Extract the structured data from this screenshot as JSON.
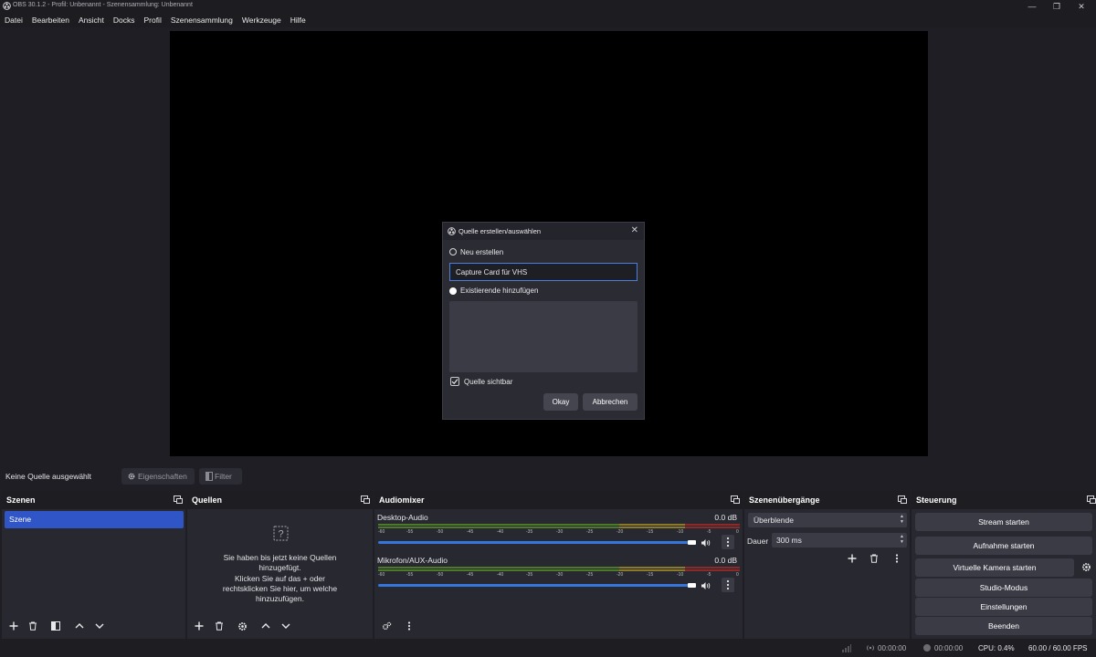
{
  "window": {
    "title": "OBS 30.1.2 - Profil: Unbenannt - Szenensammlung: Unbenannt",
    "minimize": "—",
    "maximize": "❐",
    "close": "✕"
  },
  "menu": [
    "Datei",
    "Bearbeiten",
    "Ansicht",
    "Docks",
    "Profil",
    "Szenensammlung",
    "Werkzeuge",
    "Hilfe"
  ],
  "dialog": {
    "title": "Quelle erstellen/auswählen",
    "close": "✕",
    "create_new_label": "Neu erstellen",
    "name_value": "Capture Card für VHS",
    "add_existing_label": "Existierende hinzufügen",
    "visible_label": "Quelle sichtbar",
    "visible_checked": true,
    "ok_label": "Okay",
    "cancel_label": "Abbrechen"
  },
  "sourcebar": {
    "no_source": "Keine Quelle ausgewählt",
    "properties": "Eigenschaften",
    "filters": "Filter"
  },
  "scenes": {
    "title": "Szenen",
    "items": [
      "Szene"
    ]
  },
  "sources": {
    "title": "Quellen",
    "empty_lines": [
      "Sie haben bis jetzt keine Quellen",
      "hinzugefügt.",
      "Klicken Sie auf das + oder",
      "rechtsklicken Sie hier, um welche",
      "hinzuzufügen."
    ]
  },
  "mixer": {
    "title": "Audiomixer",
    "tick_labels": [
      "-60",
      "-55",
      "-50",
      "-45",
      "-40",
      "-35",
      "-30",
      "-25",
      "-20",
      "-15",
      "-10",
      "-5",
      "0"
    ],
    "channels": [
      {
        "name": "Desktop-Audio",
        "db": "0.0 dB",
        "volume_fraction": 1.0
      },
      {
        "name": "Mikrofon/AUX-Audio",
        "db": "0.0 dB",
        "volume_fraction": 1.0
      }
    ]
  },
  "transitions": {
    "title": "Szenenübergänge",
    "selected": "Überblende",
    "duration_label": "Dauer",
    "duration_value": "300 ms"
  },
  "controls": {
    "title": "Steuerung",
    "stream": "Stream starten",
    "record": "Aufnahme starten",
    "virtualcam": "Virtuelle Kamera starten",
    "studio": "Studio-Modus",
    "settings": "Einstellungen",
    "exit": "Beenden"
  },
  "status": {
    "stream_time": "00:00:00",
    "record_time": "00:00:00",
    "cpu": "CPU: 0.4%",
    "fps": "60.00 / 60.00 FPS"
  },
  "colors": {
    "accent": "#2f55c6",
    "meter_green": "#4d7a2a",
    "meter_yellow": "#8a7a2a",
    "meter_red": "#8a2a2a",
    "volume_blue": "#3476dc"
  }
}
